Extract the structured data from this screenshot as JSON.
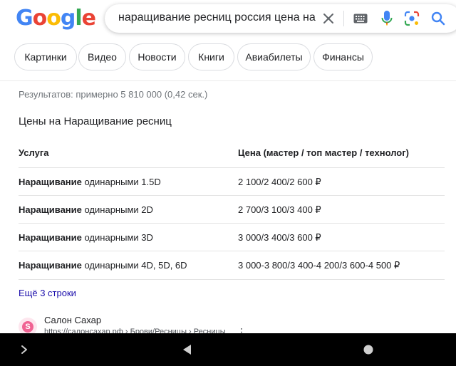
{
  "logo": {
    "letters": [
      "G",
      "o",
      "o",
      "g",
      "l",
      "e"
    ],
    "colors": [
      "#4285F4",
      "#EA4335",
      "#FBBC05",
      "#4285F4",
      "#34A853",
      "#EA4335"
    ]
  },
  "search": {
    "query": "наращивание ресниц россия цена на ус",
    "icons": [
      "clear-icon",
      "keyboard-icon",
      "microphone-icon",
      "lens-icon",
      "search-icon"
    ]
  },
  "chips": [
    "Картинки",
    "Видео",
    "Новости",
    "Книги",
    "Авиабилеты",
    "Финансы"
  ],
  "stats": "Результатов: примерно 5 810 000 (0,42 сек.)",
  "price_table": {
    "title": "Цены на Наращивание ресниц",
    "headers": [
      "Услуга",
      "Цена (мастер / топ мастер / технолог)"
    ],
    "rows": [
      {
        "bold": "Наращивание",
        "rest": " одинарными 1.5D",
        "price": "2 100/2 400/2 600 ₽"
      },
      {
        "bold": "Наращивание",
        "rest": " одинарными 2D",
        "price": "2 700/3 100/3 400 ₽"
      },
      {
        "bold": "Наращивание",
        "rest": " одинарными 3D",
        "price": "3 000/3 400/3 600 ₽"
      },
      {
        "bold": "Наращивание",
        "rest": " одинарными 4D, 5D, 6D",
        "price": "3 000-3 800/3 400-4 200/3 600-4 500 ₽"
      }
    ],
    "more_label": "Ещё 3 строки"
  },
  "result": {
    "favicon_letter": "S",
    "site_name": "Салон Сахар",
    "url": "https://салонсахар.рф › Брови/Ресницы › Ресницы"
  },
  "colors": {
    "accent_blue": "#4285F4",
    "link": "#1a0dab",
    "mic_blue": "#4285F4"
  }
}
